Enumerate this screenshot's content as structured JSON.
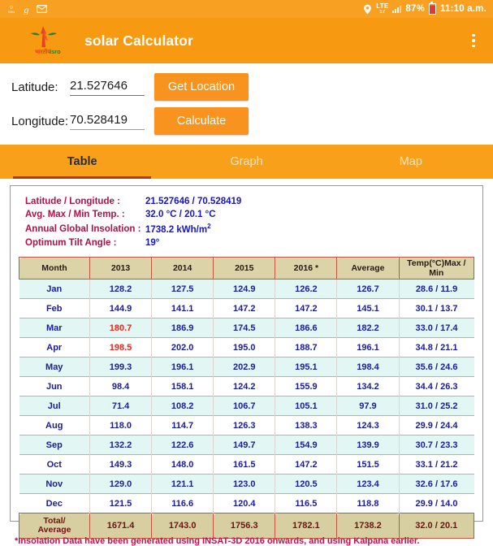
{
  "status_bar": {
    "icons_left": [
      "data-usage-icon",
      "app-notification-icon",
      "email-icon"
    ],
    "location_icon": "location-pin-icon",
    "network_type": "LTE",
    "network_sub": "17",
    "signal_icon": "signal-bars-icon",
    "battery_percent": "87%",
    "battery_icon": "battery-icon",
    "time": "11:10 a.m."
  },
  "app_bar": {
    "logo": "isro-logo-icon",
    "title": "solar Calculator",
    "overflow_icon": "overflow-menu-icon"
  },
  "inputs": {
    "latitude_label": "Latitude:",
    "latitude_value": "21.527646",
    "latitude_placeholder": "Latitude",
    "longitude_label": "Longitude:",
    "longitude_value": "70.528419",
    "longitude_placeholder": "Longitude",
    "get_location_label": "Get Location",
    "calculate_label": "Calculate"
  },
  "tabs": [
    {
      "label": "Table",
      "active": true
    },
    {
      "label": "Graph",
      "active": false
    },
    {
      "label": "Map",
      "active": false
    }
  ],
  "summary": [
    {
      "label": "Latitude / Longitude :",
      "value": "21.527646 / 70.528419"
    },
    {
      "label": "Avg. Max / Min Temp. :",
      "value": "32.0  °C / 20.1 °C"
    },
    {
      "label": "Annual Global Insolation :",
      "value": "1738.2  kWh/m",
      "sup": "2"
    },
    {
      "label": "Optimum Tilt Angle :",
      "value": "19°"
    }
  ],
  "table": {
    "columns": [
      "Month",
      "2013",
      "2014",
      "2015",
      "2016 *",
      "Average",
      "Temp(°C)Max / Min"
    ],
    "rows": [
      {
        "month": "Jan",
        "v2013": "128.2",
        "v2014": "127.5",
        "v2015": "124.9",
        "v2016": "126.2",
        "avg": "126.7",
        "temp": "28.6 / 11.9",
        "highlight": false
      },
      {
        "month": "Feb",
        "v2013": "144.9",
        "v2014": "141.1",
        "v2015": "147.2",
        "v2016": "147.2",
        "avg": "145.1",
        "temp": "30.1 / 13.7",
        "highlight": false
      },
      {
        "month": "Mar",
        "v2013": "180.7",
        "v2014": "186.9",
        "v2015": "174.5",
        "v2016": "186.6",
        "avg": "182.2",
        "temp": "33.0 / 17.4",
        "highlight": true
      },
      {
        "month": "Apr",
        "v2013": "198.5",
        "v2014": "202.0",
        "v2015": "195.0",
        "v2016": "188.7",
        "avg": "196.1",
        "temp": "34.8 / 21.1",
        "highlight": true
      },
      {
        "month": "May",
        "v2013": "199.3",
        "v2014": "196.1",
        "v2015": "202.9",
        "v2016": "195.1",
        "avg": "198.4",
        "temp": "35.6 / 24.6",
        "highlight": false
      },
      {
        "month": "Jun",
        "v2013": "98.4",
        "v2014": "158.1",
        "v2015": "124.2",
        "v2016": "155.9",
        "avg": "134.2",
        "temp": "34.4 / 26.3",
        "highlight": false
      },
      {
        "month": "Jul",
        "v2013": "71.4",
        "v2014": "108.2",
        "v2015": "106.7",
        "v2016": "105.1",
        "avg": "97.9",
        "temp": "31.0 / 25.2",
        "highlight": false
      },
      {
        "month": "Aug",
        "v2013": "118.0",
        "v2014": "114.7",
        "v2015": "126.3",
        "v2016": "138.3",
        "avg": "124.3",
        "temp": "29.9 / 24.4",
        "highlight": false
      },
      {
        "month": "Sep",
        "v2013": "132.2",
        "v2014": "122.6",
        "v2015": "149.7",
        "v2016": "154.9",
        "avg": "139.9",
        "temp": "30.7 / 23.3",
        "highlight": false
      },
      {
        "month": "Oct",
        "v2013": "149.3",
        "v2014": "148.0",
        "v2015": "161.5",
        "v2016": "147.2",
        "avg": "151.5",
        "temp": "33.1 / 21.2",
        "highlight": false
      },
      {
        "month": "Nov",
        "v2013": "129.0",
        "v2014": "121.1",
        "v2015": "123.0",
        "v2016": "120.5",
        "avg": "123.4",
        "temp": "32.6 / 17.6",
        "highlight": false
      },
      {
        "month": "Dec",
        "v2013": "121.5",
        "v2014": "116.6",
        "v2015": "120.4",
        "v2016": "116.5",
        "avg": "118.8",
        "temp": "29.9 / 14.0",
        "highlight": false
      }
    ],
    "totals": {
      "month_line1": "Total/",
      "month_line2": "Average",
      "v2013": "1671.4",
      "v2014": "1743.0",
      "v2015": "1756.3",
      "v2016": "1782.1",
      "avg": "1738.2",
      "temp": "32.0 / 20.1"
    }
  },
  "footnote": "*Insolation Data have been generated using INSAT-3D 2016 onwards, and using Kalpana earlier.",
  "colors": {
    "app_bar": "#F79A12",
    "tab_bar": "#F9A01B",
    "button": "#F7931E",
    "tab_indicator": "#b5361f",
    "table_header_bg": "#dcd4a8",
    "table_border": "#c6533f",
    "row_stripe": "#e2f7f4",
    "value_text": "#1b1b9e",
    "highlight_text": "#f0231a",
    "summary_label": "#b31046",
    "footnote": "#c01050"
  }
}
